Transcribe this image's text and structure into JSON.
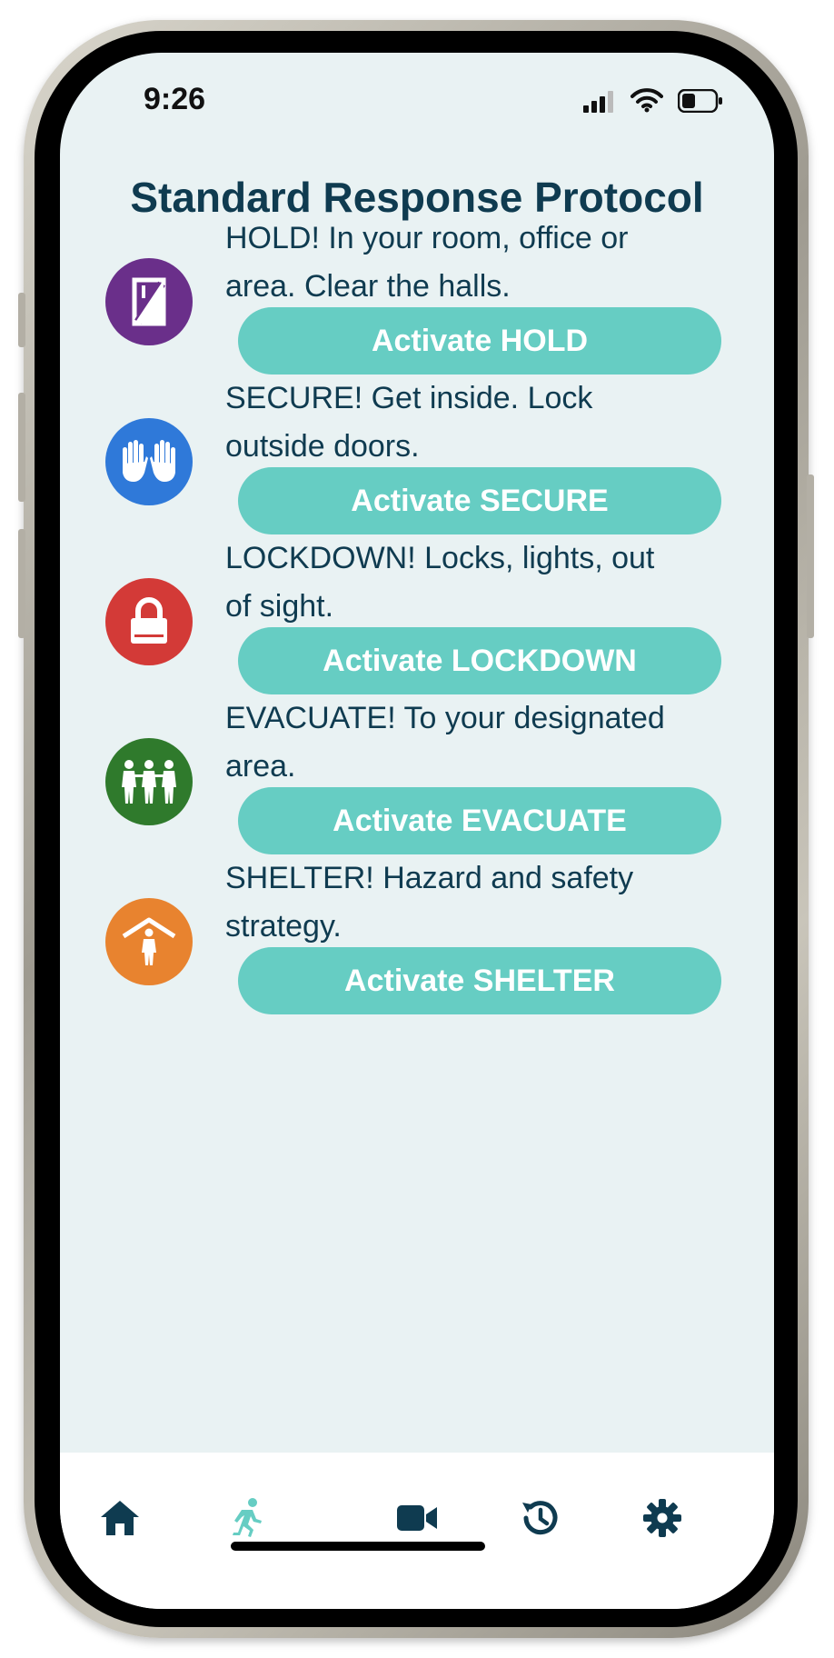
{
  "status_bar": {
    "time": "9:26"
  },
  "title": "Standard Response Protocol",
  "protocols": [
    {
      "id": "hold",
      "description_lines": [
        "HOLD! In your room, office or",
        "area. Clear the halls."
      ],
      "button_label": "Activate HOLD",
      "color": "#6a2f8a",
      "icon": "door-icon"
    },
    {
      "id": "secure",
      "description_lines": [
        "SECURE! Get inside. Lock",
        "outside doors."
      ],
      "button_label": "Activate SECURE",
      "color": "#2f79d9",
      "icon": "hands-icon"
    },
    {
      "id": "lockdown",
      "description_lines": [
        "LOCKDOWN! Locks, lights, out",
        "of sight."
      ],
      "button_label": "Activate LOCKDOWN",
      "color": "#d33a37",
      "icon": "padlock-icon"
    },
    {
      "id": "evacuate",
      "description_lines": [
        "EVACUATE! To your designated",
        "area."
      ],
      "button_label": "Activate EVACUATE",
      "color": "#2f7a2c",
      "icon": "people-icon"
    },
    {
      "id": "shelter",
      "description_lines": [
        "SHELTER! Hazard and safety",
        "strategy."
      ],
      "button_label": "Activate SHELTER",
      "color": "#e8832f",
      "icon": "shelter-icon"
    }
  ],
  "tab_bar": {
    "tabs": [
      {
        "name": "home",
        "icon": "home-icon",
        "active": false
      },
      {
        "name": "protocol",
        "icon": "running-person-icon",
        "active": true
      },
      {
        "name": "video",
        "icon": "video-camera-icon",
        "active": false
      },
      {
        "name": "history",
        "icon": "history-icon",
        "active": false
      },
      {
        "name": "settings",
        "icon": "gear-icon",
        "active": false
      }
    ],
    "active_color": "#66cdc3",
    "inactive_color": "#0f3b50"
  },
  "colors": {
    "accent": "#66cdc3",
    "text": "#0f3b50",
    "background": "#e9f2f3"
  }
}
